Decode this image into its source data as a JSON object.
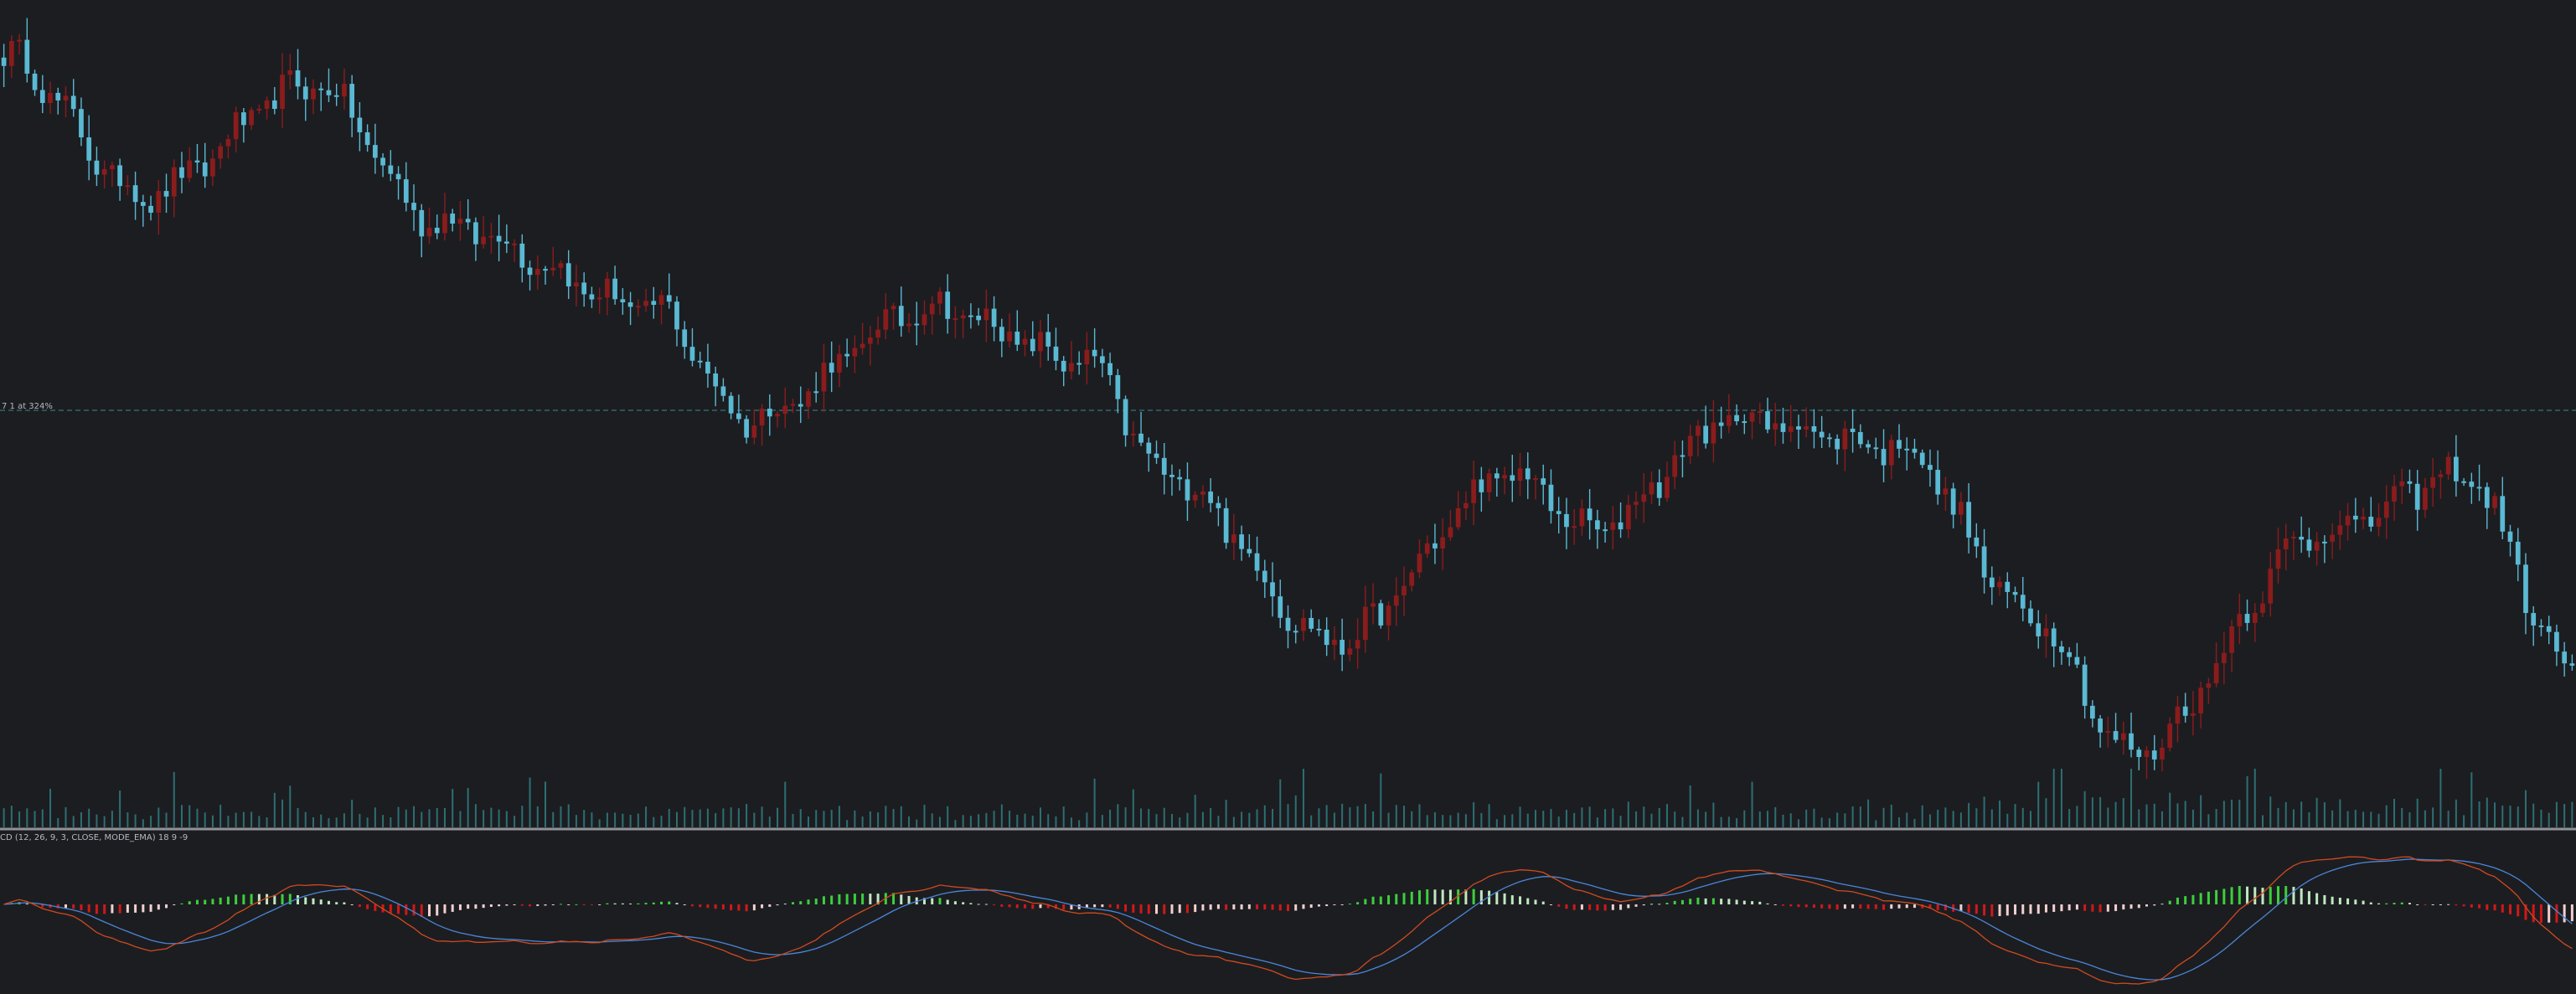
{
  "colors": {
    "background": "#1c1d21",
    "bull": "#8b1c1c",
    "bear": "#5ab9d3",
    "volume": "#2c6f73",
    "separator": "#8f9298",
    "hline": "#3a8c8f",
    "hist_pos": "#3ccf3c",
    "hist_neg": "#d11818",
    "hist_pos_fading": "#bfe8bf",
    "hist_neg_fading": "#f2cfcf",
    "macd_line": "#d04a1e",
    "signal_line": "#4a86d8"
  },
  "labels": {
    "hline_label": "7 1 at 324%",
    "indicator_label": "CD (12, 26, 9, 3, CLOSE, MODE_EMA) 18 9 -9"
  },
  "chart_data": {
    "type": "candlestick",
    "x_axis": "bar index (no dates printed)",
    "price_reference_line": 23.3,
    "price_anchors": [
      {
        "bar": 0,
        "close": 36
      },
      {
        "bar": 18,
        "close": 31
      },
      {
        "bar": 40,
        "close": 35
      },
      {
        "bar": 56,
        "close": 30
      },
      {
        "bar": 84,
        "close": 27
      },
      {
        "bar": 96,
        "close": 23
      },
      {
        "bar": 120,
        "close": 27
      },
      {
        "bar": 140,
        "close": 25
      },
      {
        "bar": 150,
        "close": 21
      },
      {
        "bar": 172,
        "close": 15
      },
      {
        "bar": 195,
        "close": 21
      },
      {
        "bar": 205,
        "close": 19
      },
      {
        "bar": 224,
        "close": 23
      },
      {
        "bar": 245,
        "close": 22
      },
      {
        "bar": 262,
        "close": 16
      },
      {
        "bar": 275,
        "close": 11
      },
      {
        "bar": 300,
        "close": 19
      },
      {
        "bar": 318,
        "close": 21
      },
      {
        "bar": 332,
        "close": 14
      }
    ],
    "bar_count": 333,
    "macd": {
      "params": "12, 26, 9, 3",
      "histogram_regions": [
        {
          "from": 0,
          "to": 18,
          "sign": "neg"
        },
        {
          "from": 18,
          "to": 50,
          "sign": "pos"
        },
        {
          "from": 50,
          "to": 58,
          "sign": "neg"
        },
        {
          "from": 58,
          "to": 84,
          "sign": "neg_small"
        },
        {
          "from": 84,
          "to": 98,
          "sign": "pos"
        },
        {
          "from": 98,
          "to": 108,
          "sign": "neg_small"
        },
        {
          "from": 108,
          "to": 135,
          "sign": "pos"
        },
        {
          "from": 135,
          "to": 175,
          "sign": "neg"
        },
        {
          "from": 175,
          "to": 210,
          "sign": "pos"
        },
        {
          "from": 210,
          "to": 218,
          "sign": "neg"
        },
        {
          "from": 218,
          "to": 232,
          "sign": "pos"
        },
        {
          "from": 232,
          "to": 250,
          "sign": "neg_small"
        },
        {
          "from": 250,
          "to": 278,
          "sign": "neg"
        },
        {
          "from": 278,
          "to": 310,
          "sign": "pos"
        },
        {
          "from": 310,
          "to": 318,
          "sign": "pos_small"
        },
        {
          "from": 318,
          "to": 333,
          "sign": "neg"
        }
      ]
    }
  }
}
